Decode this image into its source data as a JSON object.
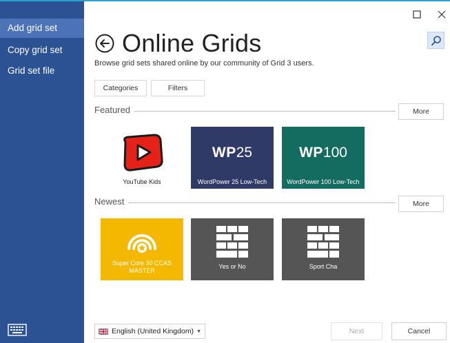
{
  "sidebar": {
    "items": [
      {
        "label": "Add grid set",
        "active": true
      },
      {
        "label": "Copy grid set",
        "active": false
      },
      {
        "label": "Grid set file",
        "active": false
      }
    ],
    "keyboard_icon": "keyboard-icon"
  },
  "window": {
    "maximize_icon": "maximize-icon",
    "close_icon": "close-icon"
  },
  "header": {
    "back_icon": "back-arrow-circle-icon",
    "title": "Online Grids",
    "subtitle": "Browse grid sets shared online by our community of Grid 3 users.",
    "search_icon": "search-icon"
  },
  "filters": {
    "categories_label": "Categories",
    "filters_label": "Filters"
  },
  "featured": {
    "label": "Featured",
    "more_label": "More",
    "tiles": [
      {
        "caption": "YouTube Kids",
        "icon": "youtube-kids-icon",
        "bg": "#ffffff"
      },
      {
        "caption": "WordPower 25 Low-Tech",
        "brand_bold": "WP",
        "brand_num": "25",
        "bg": "#2f3a66"
      },
      {
        "caption": "WordPower 100 Low-Tech",
        "brand_bold": "WP",
        "brand_num": "100",
        "bg": "#146b5f"
      }
    ]
  },
  "newest": {
    "label": "Newest",
    "more_label": "More",
    "tiles": [
      {
        "caption": "Super Core 30  CCAS MASTER",
        "icon": "super-core-star-icon",
        "bg": "#f5b800"
      },
      {
        "caption": "Yes or No",
        "icon": "grid-blocks-icon",
        "bg": "#555555"
      },
      {
        "caption": "Sport Cha",
        "icon": "grid-blocks-icon",
        "bg": "#555555"
      }
    ]
  },
  "footer": {
    "language": "English (United Kingdom)",
    "flag_icon": "uk-flag-icon",
    "next_label": "Next",
    "cancel_label": "Cancel"
  },
  "colors": {
    "sidebar": "#2d5294",
    "sidebar_active": "#4c73b7",
    "accent": "#2a9fd6"
  }
}
